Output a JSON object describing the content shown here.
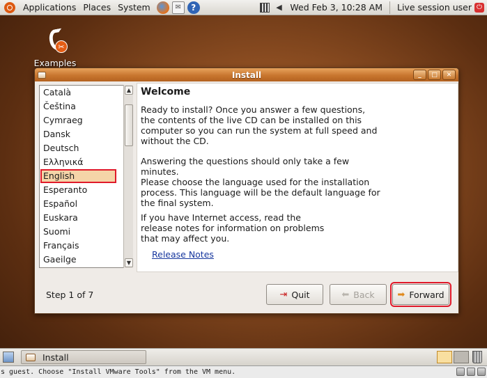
{
  "top_panel": {
    "menus": [
      "Applications",
      "Places",
      "System"
    ],
    "clock": "Wed Feb  3, 10:28 AM",
    "session": "Live session user"
  },
  "desktop": {
    "icon_label": "Examples"
  },
  "window": {
    "title": "Install",
    "heading": "Welcome",
    "paragraphs": [
      "Ready to install? Once you answer a few questions, the contents of the live CD can be installed on this computer so you can run the system at full speed and without the CD.",
      "Answering the questions should only take a few minutes.",
      "Please choose the language used for the installation process. This language will be the default language for the final system.",
      "If you have Internet access, read the release notes for information on problems that may affect you."
    ],
    "release_notes": "Release Notes",
    "step": "Step 1 of 7",
    "buttons": {
      "quit": "Quit",
      "back": "Back",
      "forward": "Forward"
    },
    "languages": [
      "Català",
      "Čeština",
      "Cymraeg",
      "Dansk",
      "Deutsch",
      "Ελληνικά",
      "English",
      "Esperanto",
      "Español",
      "Euskara",
      "Suomi",
      "Français",
      "Gaeilge"
    ],
    "selected_language": "English"
  },
  "taskbar": {
    "items": [
      "Install"
    ]
  },
  "status_bar": {
    "text": "s guest. Choose \"Install VMware Tools\" from the VM menu."
  },
  "colors": {
    "accent": "#c8762f",
    "highlight": "#e0192a",
    "link": "#17379e"
  },
  "icons": [
    "ubuntu-logo-icon",
    "firefox-icon",
    "mail-icon",
    "help-icon",
    "network-icon",
    "volume-icon",
    "power-icon",
    "examples-icon",
    "install-app-icon",
    "quit-icon",
    "back-arrow-icon",
    "forward-arrow-icon",
    "show-desktop-icon",
    "trash-icon"
  ]
}
